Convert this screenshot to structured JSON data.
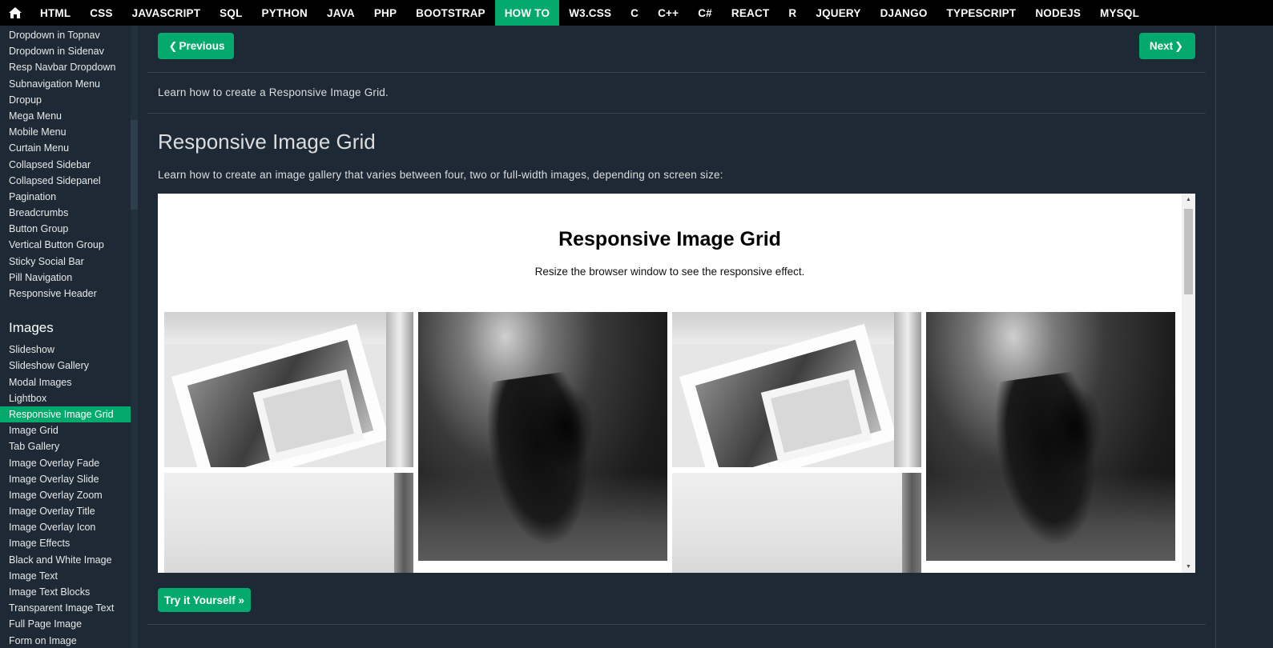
{
  "topnav": {
    "home_icon": "home-icon",
    "items": [
      {
        "label": "HTML"
      },
      {
        "label": "CSS"
      },
      {
        "label": "JAVASCRIPT"
      },
      {
        "label": "SQL"
      },
      {
        "label": "PYTHON"
      },
      {
        "label": "JAVA"
      },
      {
        "label": "PHP"
      },
      {
        "label": "BOOTSTRAP"
      },
      {
        "label": "HOW TO",
        "active": true
      },
      {
        "label": "W3.CSS"
      },
      {
        "label": "C"
      },
      {
        "label": "C++"
      },
      {
        "label": "C#"
      },
      {
        "label": "REACT"
      },
      {
        "label": "R"
      },
      {
        "label": "JQUERY"
      },
      {
        "label": "DJANGO"
      },
      {
        "label": "TYPESCRIPT"
      },
      {
        "label": "NODEJS"
      },
      {
        "label": "MYSQL"
      }
    ],
    "active_color": "#04aa6d"
  },
  "sidebar": {
    "menu_items": [
      "Dropdown in Topnav",
      "Dropdown in Sidenav",
      "Resp Navbar Dropdown",
      "Subnavigation Menu",
      "Dropup",
      "Mega Menu",
      "Mobile Menu",
      "Curtain Menu",
      "Collapsed Sidebar",
      "Collapsed Sidepanel",
      "Pagination",
      "Breadcrumbs",
      "Button Group",
      "Vertical Button Group",
      "Sticky Social Bar",
      "Pill Navigation",
      "Responsive Header"
    ],
    "images_heading": "Images",
    "image_items": [
      "Slideshow",
      "Slideshow Gallery",
      "Modal Images",
      "Lightbox",
      "Responsive Image Grid",
      "Image Grid",
      "Tab Gallery",
      "Image Overlay Fade",
      "Image Overlay Slide",
      "Image Overlay Zoom",
      "Image Overlay Title",
      "Image Overlay Icon",
      "Image Effects",
      "Black and White Image",
      "Image Text",
      "Image Text Blocks",
      "Transparent Image Text",
      "Full Page Image",
      "Form on Image"
    ],
    "active_item": "Responsive Image Grid"
  },
  "main": {
    "previous_label": "Previous",
    "next_label": "Next",
    "intro": "Learn how to create a Responsive Image Grid.",
    "title": "Responsive Image Grid",
    "description": "Learn how to create an image gallery that varies between four, two or full-width images, depending on screen size:",
    "try_label": "Try it Yourself »"
  },
  "demo": {
    "title": "Responsive Image Grid",
    "subtitle": "Resize the browser window to see the responsive effect.",
    "images": [
      "wedding-car-photo",
      "underwater-photo",
      "foggy-cliff-photo"
    ]
  },
  "colors": {
    "background": "#1d2a35",
    "accent": "#04aa6d",
    "topnav": "#000000"
  }
}
